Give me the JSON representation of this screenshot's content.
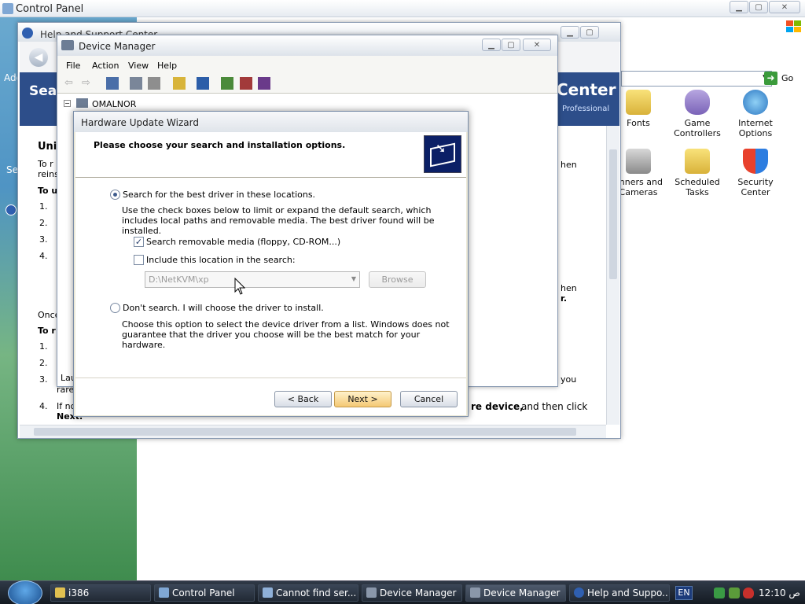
{
  "control_panel": {
    "title": "Control Panel",
    "go_label": "Go",
    "icons": [
      {
        "label": "Fonts"
      },
      {
        "label": "Game Controllers"
      },
      {
        "label": "Internet Options"
      },
      {
        "label": "anners and Cameras"
      },
      {
        "label": "Scheduled Tasks"
      },
      {
        "label": "Security Center"
      }
    ],
    "left_fragments": [
      "Add",
      "Se"
    ]
  },
  "help_support": {
    "title": "Help and Support Center",
    "banner_search": "Sear",
    "banner_center": "Center",
    "banner_edition": "Professional",
    "left_text": {
      "heading": "Uni",
      "line1": "To r",
      "line2": "reins",
      "line3": "To u",
      "steps1": [
        "1.",
        "2.",
        "3.",
        "4."
      ],
      "once": "Once",
      "line4": "To r",
      "steps2": [
        "1.",
        "2.",
        "3.",
        "4."
      ],
      "rare": "rare",
      "if_no": "If no",
      "next_frag": "Next."
    },
    "right_text": {
      "hen1": "hen",
      "hen2": "hen",
      "r": "r.",
      "you": "you",
      "device_bold": "re device,",
      "then_click": "and then click"
    }
  },
  "device_manager": {
    "title": "Device Manager",
    "menu": [
      "File",
      "Action",
      "View",
      "Help"
    ],
    "tree_root": "OMALNOR",
    "status_frag": "Lau"
  },
  "wizard": {
    "title": "Hardware Update Wizard",
    "header": "Please choose your search and installation options.",
    "option_search": "Search for the best driver in these locations.",
    "option_search_desc": "Use the check boxes below to limit or expand the default search, which includes local paths and removable media. The best driver found will be installed.",
    "check_removable": "Search removable media (floppy, CD-ROM...)",
    "check_removable_checked": true,
    "check_location": "Include this location in the search:",
    "check_location_checked": false,
    "location_value": "D:\\NetKVM\\xp",
    "browse_label": "Browse",
    "option_dont": "Don't search. I will choose the driver to install.",
    "option_dont_desc": "Choose this option to select the device driver from a list.  Windows does not guarantee that the driver you choose will be the best match for your hardware.",
    "back_label": "< Back",
    "next_label": "Next >",
    "cancel_label": "Cancel"
  },
  "taskbar": {
    "tasks": [
      {
        "label": "i386"
      },
      {
        "label": "Control Panel"
      },
      {
        "label": "Cannot find ser..."
      },
      {
        "label": "Device Manager"
      },
      {
        "label": "Device Manager"
      },
      {
        "label": "Help and Suppo..."
      }
    ],
    "lang": "EN",
    "clock": "12:10 ص"
  },
  "colors": {
    "accent": "#2d4e8a",
    "next_button": "#f4c874"
  }
}
